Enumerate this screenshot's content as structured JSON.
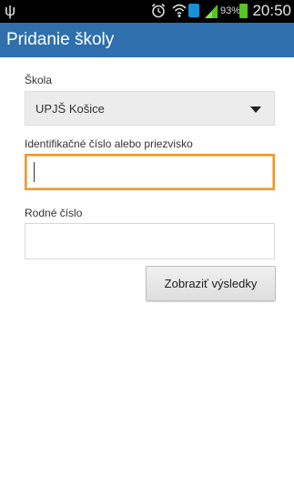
{
  "status_bar": {
    "battery_percent": "93%",
    "clock": "20:50",
    "icons": [
      "usb-icon",
      "alarm-icon",
      "wifi-icon",
      "data-icon",
      "signal-icon",
      "battery-icon"
    ]
  },
  "action_bar": {
    "title": "Pridanie školy"
  },
  "form": {
    "school_label": "Škola",
    "school_selected": "UPJŠ Košice",
    "id_label": "Identifikačné číslo alebo priezvisko",
    "id_value": "",
    "birth_label": "Rodné číslo",
    "birth_value": "",
    "submit_label": "Zobraziť výsledky"
  },
  "colors": {
    "action_bar": "#2f6fae",
    "focus_border": "#f0962a"
  }
}
